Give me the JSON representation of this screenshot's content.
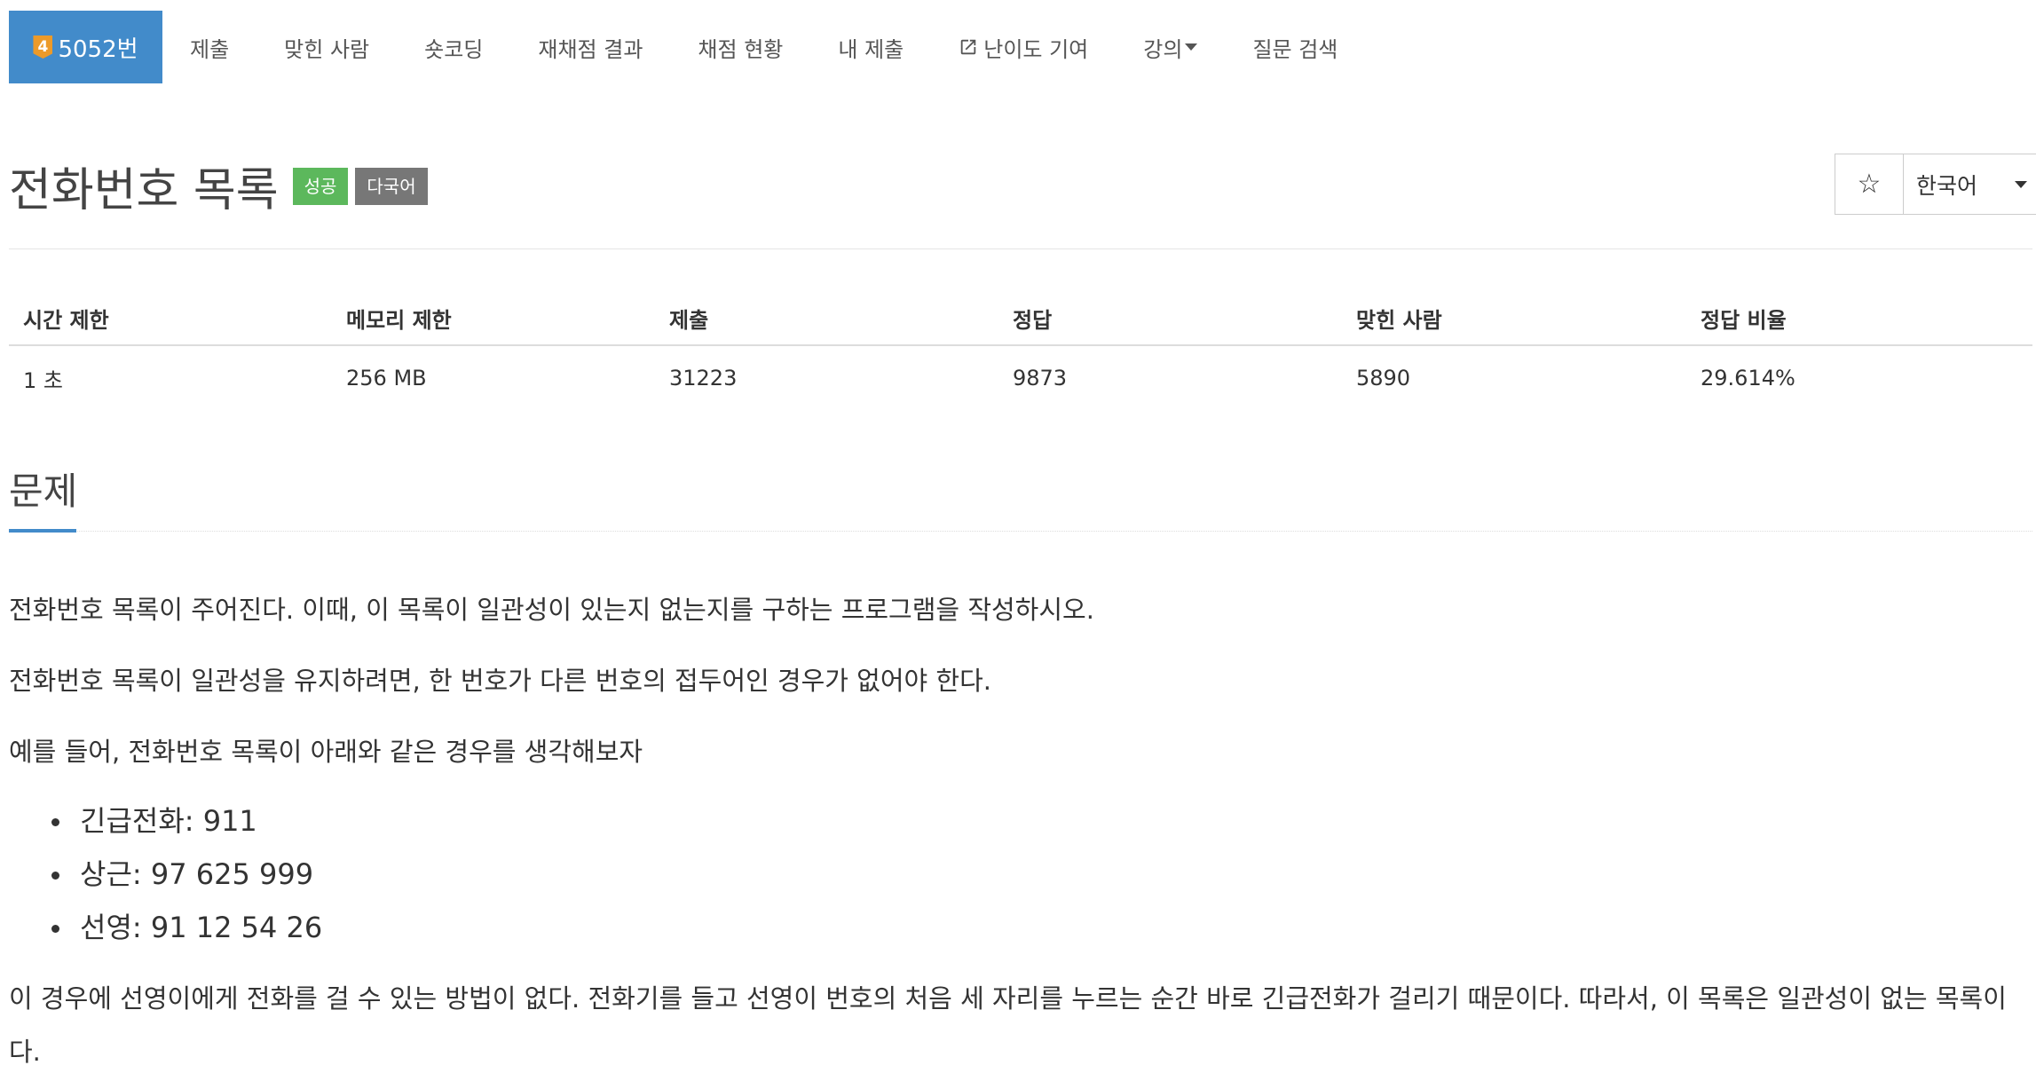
{
  "nav": {
    "tier": "4",
    "problem_id": "5052번",
    "items": [
      "제출",
      "맞힌 사람",
      "숏코딩",
      "재채점 결과",
      "채점 현황",
      "내 제출",
      "난이도 기여",
      "강의",
      "질문 검색"
    ]
  },
  "title": {
    "text": "전화번호 목록",
    "labels": [
      "성공",
      "다국어"
    ]
  },
  "controls": {
    "star": "☆",
    "language": "한국어"
  },
  "stats": {
    "headers": [
      "시간 제한",
      "메모리 제한",
      "제출",
      "정답",
      "맞힌 사람",
      "정답 비율"
    ],
    "values": [
      "1 초",
      "256 MB",
      "31223",
      "9873",
      "5890",
      "29.614%"
    ]
  },
  "section": {
    "title": "문제",
    "paragraphs": [
      "전화번호 목록이 주어진다. 이때, 이 목록이 일관성이 있는지 없는지를 구하는 프로그램을 작성하시오.",
      "전화번호 목록이 일관성을 유지하려면, 한 번호가 다른 번호의 접두어인 경우가 없어야 한다.",
      "예를 들어, 전화번호 목록이 아래와 같은 경우를 생각해보자"
    ],
    "bullets": [
      "긴급전화: 911",
      "상근: 97 625 999",
      "선영: 91 12 54 26"
    ],
    "closing": "이 경우에 선영이에게 전화를 걸 수 있는 방법이 없다. 전화기를 들고 선영이 번호의 처음 세 자리를 누르는 순간 바로 긴급전화가 걸리기 때문이다. 따라서, 이 목록은 일관성이 없는 목록이다."
  },
  "colors": {
    "primary": "#428bca",
    "success": "#5cb85c",
    "default": "#777777",
    "tier": "#ec9a29"
  }
}
